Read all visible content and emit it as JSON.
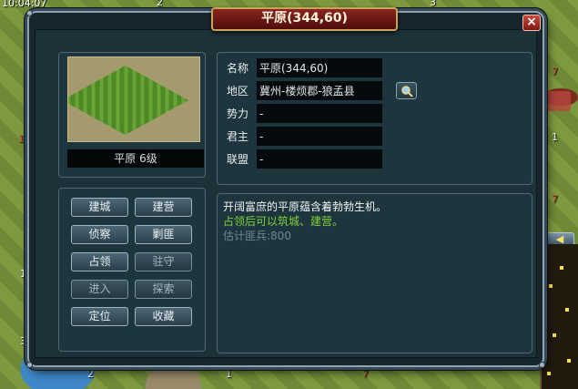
{
  "clock": "10:04:07",
  "map": {
    "tile_numbers": [
      "2",
      "3",
      "1",
      "7",
      "1",
      "3",
      "2",
      "1",
      "7"
    ],
    "red_numbers": [
      "12",
      "7",
      "3",
      "1",
      "7"
    ],
    "minimap_button": "◀"
  },
  "dialog": {
    "title": "平原(344,60)",
    "close_label": "×",
    "thumbnail": {
      "label": "平原 6级"
    },
    "info": {
      "name_label": "名称",
      "name_value": "平原(344,60)",
      "region_label": "地区",
      "region_value": "冀州-楼烦郡-狼孟县",
      "faction_label": "势力",
      "faction_value": "-",
      "lord_label": "君主",
      "lord_value": "-",
      "alliance_label": "联盟",
      "alliance_value": "-"
    },
    "actions": {
      "build_city": "建城",
      "build_camp": "建营",
      "scout": "侦察",
      "suppress_bandits": "剿匪",
      "occupy": "占领",
      "garrison": "驻守",
      "enter": "进入",
      "explore": "探索",
      "locate": "定位",
      "favorite": "收藏"
    },
    "description": {
      "line1": "开阔富庶的平原蕴含着勃勃生机。",
      "line2": "占领后可以筑城、建营。",
      "line3": "估计匪兵:800"
    },
    "colors": {
      "title_red": "#8b241e",
      "hint_green": "#7fd03b",
      "estimate_gray": "#6e8791"
    }
  }
}
